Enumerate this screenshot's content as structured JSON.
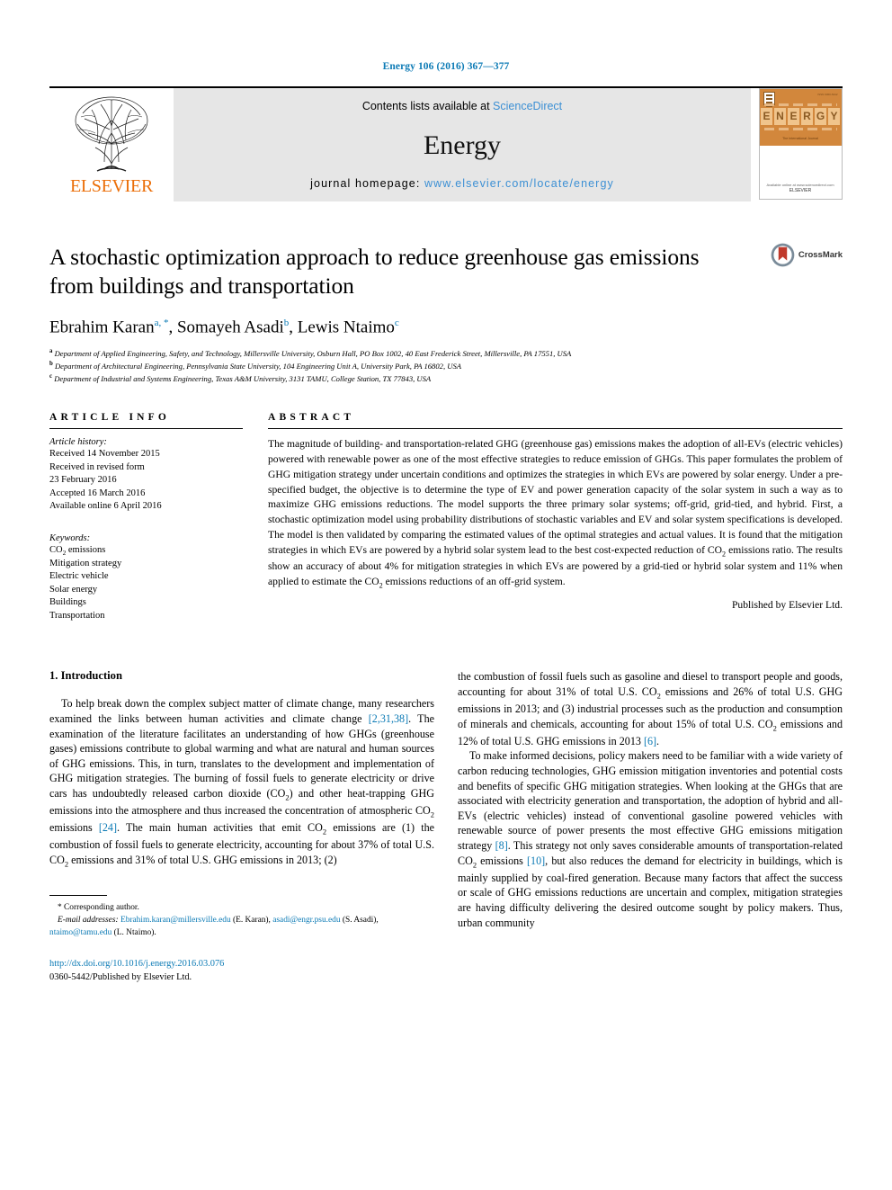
{
  "running_head": "Energy 106 (2016) 367—377",
  "masthead": {
    "publisher_word": "ELSEVIER",
    "contents_prefix": "Contents lists available at",
    "contents_link": "ScienceDirect",
    "journal_title": "Energy",
    "homepage_label": "journal homepage:",
    "homepage_url": "www.elsevier.com/locate/energy",
    "cover": {
      "title_letters": [
        "E",
        "N",
        "E",
        "R",
        "G",
        "Y"
      ],
      "issn_text": "ISSN 0360-5442",
      "subtitle": "The International Journal",
      "footer_publisher": "ELSEVIER",
      "footer_note": "Available online at www.sciencedirect.com"
    }
  },
  "article": {
    "title": "A stochastic optimization approach to reduce greenhouse gas emissions from buildings and transportation",
    "crossmark_label": "CrossMark",
    "authors": [
      {
        "name": "Ebrahim Karan",
        "marks": "a, *"
      },
      {
        "name": "Somayeh Asadi",
        "marks": "b"
      },
      {
        "name": "Lewis Ntaimo",
        "marks": "c"
      }
    ],
    "affiliations": [
      {
        "mark": "a",
        "text": "Department of Applied Engineering, Safety, and Technology, Millersville University, Osburn Hall, PO Box 1002, 40 East Frederick Street, Millersville, PA 17551, USA"
      },
      {
        "mark": "b",
        "text": "Department of Architectural Engineering, Pennsylvania State University, 104 Engineering Unit A, University Park, PA 16802, USA"
      },
      {
        "mark": "c",
        "text": "Department of Industrial and Systems Engineering, Texas A&M University, 3131 TAMU, College Station, TX 77843, USA"
      }
    ]
  },
  "article_info": {
    "heading": "ARTICLE INFO",
    "history_label": "Article history:",
    "history": [
      "Received 14 November 2015",
      "Received in revised form",
      "23 February 2016",
      "Accepted 16 March 2016",
      "Available online 6 April 2016"
    ],
    "keywords_label": "Keywords:",
    "keywords": [
      "CO2 emissions",
      "Mitigation strategy",
      "Electric vehicle",
      "Solar energy",
      "Buildings",
      "Transportation"
    ]
  },
  "abstract": {
    "heading": "ABSTRACT",
    "text": "The magnitude of building- and transportation-related GHG (greenhouse gas) emissions makes the adoption of all-EVs (electric vehicles) powered with renewable power as one of the most effective strategies to reduce emission of GHGs. This paper formulates the problem of GHG mitigation strategy under uncertain conditions and optimizes the strategies in which EVs are powered by solar energy. Under a pre-specified budget, the objective is to determine the type of EV and power generation capacity of the solar system in such a way as to maximize GHG emissions reductions. The model supports the three primary solar systems; off-grid, grid-tied, and hybrid. First, a stochastic optimization model using probability distributions of stochastic variables and EV and solar system specifications is developed. The model is then validated by comparing the estimated values of the optimal strategies and actual values. It is found that the mitigation strategies in which EVs are powered by a hybrid solar system lead to the best cost-expected reduction of CO2 emissions ratio. The results show an accuracy of about 4% for mitigation strategies in which EVs are powered by a grid-tied or hybrid solar system and 11% when applied to estimate the CO2 emissions reductions of an off-grid system.",
    "publisher_line": "Published by Elsevier Ltd."
  },
  "introduction": {
    "heading": "1. Introduction",
    "left_paragraph_1_a": "To help break down the complex subject matter of climate change, many researchers examined the links between human activities and climate change ",
    "left_cite_1": "[2,31,38]",
    "left_paragraph_1_b": ". The examination of the literature facilitates an understanding of how GHGs (greenhouse gases) emissions contribute to global warming and what are natural and human sources of GHG emissions. This, in turn, translates to the development and implementation of GHG mitigation strategies. The burning of fossil fuels to generate electricity or drive cars has undoubtedly released carbon dioxide (CO2) and other heat-trapping GHG emissions into the atmosphere and thus increased the concentration of atmospheric CO2 emissions ",
    "left_cite_2": "[24]",
    "left_paragraph_1_c": ". The main human activities that emit CO2 emissions are (1) the combustion of fossil fuels to generate electricity, accounting for about 37% of total U.S. CO2 emissions and 31% of total U.S. GHG emissions in 2013; (2)",
    "right_paragraph_1_a": "the combustion of fossil fuels such as gasoline and diesel to transport people and goods, accounting for about 31% of total U.S. CO2 emissions and 26% of total U.S. GHG emissions in 2013; and (3) industrial processes such as the production and consumption of minerals and chemicals, accounting for about 15% of total U.S. CO2 emissions and 12% of total U.S. GHG emissions in 2013 ",
    "right_cite_1": "[6]",
    "right_paragraph_1_b": ".",
    "right_paragraph_2_a": "To make informed decisions, policy makers need to be familiar with a wide variety of carbon reducing technologies, GHG emission mitigation inventories and potential costs and benefits of specific GHG mitigation strategies. When looking at the GHGs that are associated with electricity generation and transportation, the adoption of hybrid and all-EVs (electric vehicles) instead of conventional gasoline powered vehicles with renewable source of power presents the most effective GHG emissions mitigation strategy ",
    "right_cite_2": "[8]",
    "right_paragraph_2_b": ". This strategy not only saves considerable amounts of transportation-related CO2 emissions ",
    "right_cite_3": "[10]",
    "right_paragraph_2_c": ", but also reduces the demand for electricity in buildings, which is mainly supplied by coal-fired generation. Because many factors that affect the success or scale of GHG emissions reductions are uncertain and complex, mitigation strategies are having difficulty delivering the desired outcome sought by policy makers. Thus, urban community"
  },
  "footnote": {
    "corresponding_marker": "*",
    "corresponding_text": "Corresponding author.",
    "email_label": "E-mail addresses:",
    "emails": [
      {
        "address": "Ebrahim.karan@millersville.edu",
        "owner": "(E. Karan)"
      },
      {
        "address": "asadi@engr.psu.edu",
        "owner": "(S. Asadi)"
      },
      {
        "address": "ntaimo@tamu.edu",
        "owner": "(L. Ntaimo)"
      }
    ]
  },
  "doi_block": {
    "doi_url": "http://dx.doi.org/10.1016/j.energy.2016.03.076",
    "issn_line": "0360-5442/Published by Elsevier Ltd."
  },
  "colors": {
    "link_blue": "#0b7ab5",
    "elsevier_orange": "#eb6e08",
    "banner_gray": "#e6e6e6",
    "crossmark_red": "#c0392b"
  }
}
